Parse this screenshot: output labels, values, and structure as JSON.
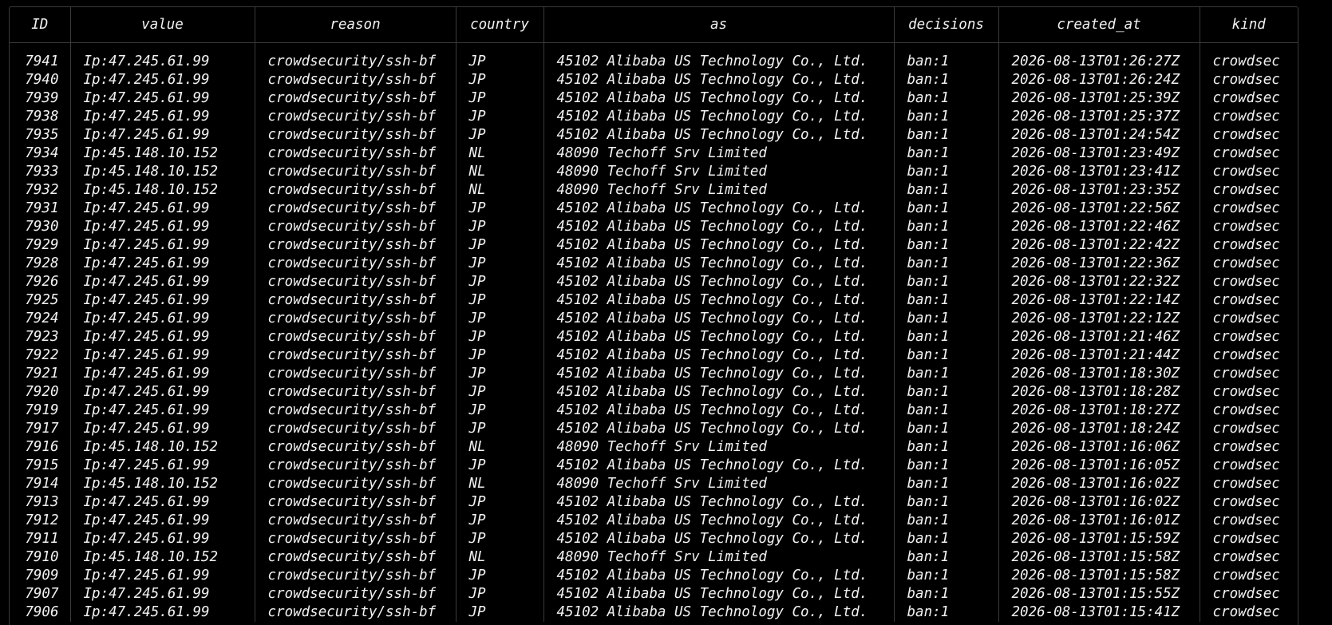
{
  "table": {
    "columns": [
      "ID",
      "value",
      "reason",
      "country",
      "as",
      "decisions",
      "created_at",
      "kind"
    ],
    "rows": [
      [
        "7941",
        "Ip:47.245.61.99",
        "crowdsecurity/ssh-bf",
        "JP",
        "45102 Alibaba US Technology Co., Ltd.",
        "ban:1",
        "2026-08-13T01:26:27Z",
        "crowdsec"
      ],
      [
        "7940",
        "Ip:47.245.61.99",
        "crowdsecurity/ssh-bf",
        "JP",
        "45102 Alibaba US Technology Co., Ltd.",
        "ban:1",
        "2026-08-13T01:26:24Z",
        "crowdsec"
      ],
      [
        "7939",
        "Ip:47.245.61.99",
        "crowdsecurity/ssh-bf",
        "JP",
        "45102 Alibaba US Technology Co., Ltd.",
        "ban:1",
        "2026-08-13T01:25:39Z",
        "crowdsec"
      ],
      [
        "7938",
        "Ip:47.245.61.99",
        "crowdsecurity/ssh-bf",
        "JP",
        "45102 Alibaba US Technology Co., Ltd.",
        "ban:1",
        "2026-08-13T01:25:37Z",
        "crowdsec"
      ],
      [
        "7935",
        "Ip:47.245.61.99",
        "crowdsecurity/ssh-bf",
        "JP",
        "45102 Alibaba US Technology Co., Ltd.",
        "ban:1",
        "2026-08-13T01:24:54Z",
        "crowdsec"
      ],
      [
        "7934",
        "Ip:45.148.10.152",
        "crowdsecurity/ssh-bf",
        "NL",
        "48090 Techoff Srv Limited",
        "ban:1",
        "2026-08-13T01:23:49Z",
        "crowdsec"
      ],
      [
        "7933",
        "Ip:45.148.10.152",
        "crowdsecurity/ssh-bf",
        "NL",
        "48090 Techoff Srv Limited",
        "ban:1",
        "2026-08-13T01:23:41Z",
        "crowdsec"
      ],
      [
        "7932",
        "Ip:45.148.10.152",
        "crowdsecurity/ssh-bf",
        "NL",
        "48090 Techoff Srv Limited",
        "ban:1",
        "2026-08-13T01:23:35Z",
        "crowdsec"
      ],
      [
        "7931",
        "Ip:47.245.61.99",
        "crowdsecurity/ssh-bf",
        "JP",
        "45102 Alibaba US Technology Co., Ltd.",
        "ban:1",
        "2026-08-13T01:22:56Z",
        "crowdsec"
      ],
      [
        "7930",
        "Ip:47.245.61.99",
        "crowdsecurity/ssh-bf",
        "JP",
        "45102 Alibaba US Technology Co., Ltd.",
        "ban:1",
        "2026-08-13T01:22:46Z",
        "crowdsec"
      ],
      [
        "7929",
        "Ip:47.245.61.99",
        "crowdsecurity/ssh-bf",
        "JP",
        "45102 Alibaba US Technology Co., Ltd.",
        "ban:1",
        "2026-08-13T01:22:42Z",
        "crowdsec"
      ],
      [
        "7928",
        "Ip:47.245.61.99",
        "crowdsecurity/ssh-bf",
        "JP",
        "45102 Alibaba US Technology Co., Ltd.",
        "ban:1",
        "2026-08-13T01:22:36Z",
        "crowdsec"
      ],
      [
        "7926",
        "Ip:47.245.61.99",
        "crowdsecurity/ssh-bf",
        "JP",
        "45102 Alibaba US Technology Co., Ltd.",
        "ban:1",
        "2026-08-13T01:22:32Z",
        "crowdsec"
      ],
      [
        "7925",
        "Ip:47.245.61.99",
        "crowdsecurity/ssh-bf",
        "JP",
        "45102 Alibaba US Technology Co., Ltd.",
        "ban:1",
        "2026-08-13T01:22:14Z",
        "crowdsec"
      ],
      [
        "7924",
        "Ip:47.245.61.99",
        "crowdsecurity/ssh-bf",
        "JP",
        "45102 Alibaba US Technology Co., Ltd.",
        "ban:1",
        "2026-08-13T01:22:12Z",
        "crowdsec"
      ],
      [
        "7923",
        "Ip:47.245.61.99",
        "crowdsecurity/ssh-bf",
        "JP",
        "45102 Alibaba US Technology Co., Ltd.",
        "ban:1",
        "2026-08-13T01:21:46Z",
        "crowdsec"
      ],
      [
        "7922",
        "Ip:47.245.61.99",
        "crowdsecurity/ssh-bf",
        "JP",
        "45102 Alibaba US Technology Co., Ltd.",
        "ban:1",
        "2026-08-13T01:21:44Z",
        "crowdsec"
      ],
      [
        "7921",
        "Ip:47.245.61.99",
        "crowdsecurity/ssh-bf",
        "JP",
        "45102 Alibaba US Technology Co., Ltd.",
        "ban:1",
        "2026-08-13T01:18:30Z",
        "crowdsec"
      ],
      [
        "7920",
        "Ip:47.245.61.99",
        "crowdsecurity/ssh-bf",
        "JP",
        "45102 Alibaba US Technology Co., Ltd.",
        "ban:1",
        "2026-08-13T01:18:28Z",
        "crowdsec"
      ],
      [
        "7919",
        "Ip:47.245.61.99",
        "crowdsecurity/ssh-bf",
        "JP",
        "45102 Alibaba US Technology Co., Ltd.",
        "ban:1",
        "2026-08-13T01:18:27Z",
        "crowdsec"
      ],
      [
        "7917",
        "Ip:47.245.61.99",
        "crowdsecurity/ssh-bf",
        "JP",
        "45102 Alibaba US Technology Co., Ltd.",
        "ban:1",
        "2026-08-13T01:18:24Z",
        "crowdsec"
      ],
      [
        "7916",
        "Ip:45.148.10.152",
        "crowdsecurity/ssh-bf",
        "NL",
        "48090 Techoff Srv Limited",
        "ban:1",
        "2026-08-13T01:16:06Z",
        "crowdsec"
      ],
      [
        "7915",
        "Ip:47.245.61.99",
        "crowdsecurity/ssh-bf",
        "JP",
        "45102 Alibaba US Technology Co., Ltd.",
        "ban:1",
        "2026-08-13T01:16:05Z",
        "crowdsec"
      ],
      [
        "7914",
        "Ip:45.148.10.152",
        "crowdsecurity/ssh-bf",
        "NL",
        "48090 Techoff Srv Limited",
        "ban:1",
        "2026-08-13T01:16:02Z",
        "crowdsec"
      ],
      [
        "7913",
        "Ip:47.245.61.99",
        "crowdsecurity/ssh-bf",
        "JP",
        "45102 Alibaba US Technology Co., Ltd.",
        "ban:1",
        "2026-08-13T01:16:02Z",
        "crowdsec"
      ],
      [
        "7912",
        "Ip:47.245.61.99",
        "crowdsecurity/ssh-bf",
        "JP",
        "45102 Alibaba US Technology Co., Ltd.",
        "ban:1",
        "2026-08-13T01:16:01Z",
        "crowdsec"
      ],
      [
        "7911",
        "Ip:47.245.61.99",
        "crowdsecurity/ssh-bf",
        "JP",
        "45102 Alibaba US Technology Co., Ltd.",
        "ban:1",
        "2026-08-13T01:15:59Z",
        "crowdsec"
      ],
      [
        "7910",
        "Ip:45.148.10.152",
        "crowdsecurity/ssh-bf",
        "NL",
        "48090 Techoff Srv Limited",
        "ban:1",
        "2026-08-13T01:15:58Z",
        "crowdsec"
      ],
      [
        "7909",
        "Ip:47.245.61.99",
        "crowdsecurity/ssh-bf",
        "JP",
        "45102 Alibaba US Technology Co., Ltd.",
        "ban:1",
        "2026-08-13T01:15:58Z",
        "crowdsec"
      ],
      [
        "7907",
        "Ip:47.245.61.99",
        "crowdsecurity/ssh-bf",
        "JP",
        "45102 Alibaba US Technology Co., Ltd.",
        "ban:1",
        "2026-08-13T01:15:55Z",
        "crowdsec"
      ],
      [
        "7906",
        "Ip:47.245.61.99",
        "crowdsecurity/ssh-bf",
        "JP",
        "45102 Alibaba US Technology Co., Ltd.",
        "ban:1",
        "2026-08-13T01:15:41Z",
        "crowdsec"
      ]
    ]
  }
}
